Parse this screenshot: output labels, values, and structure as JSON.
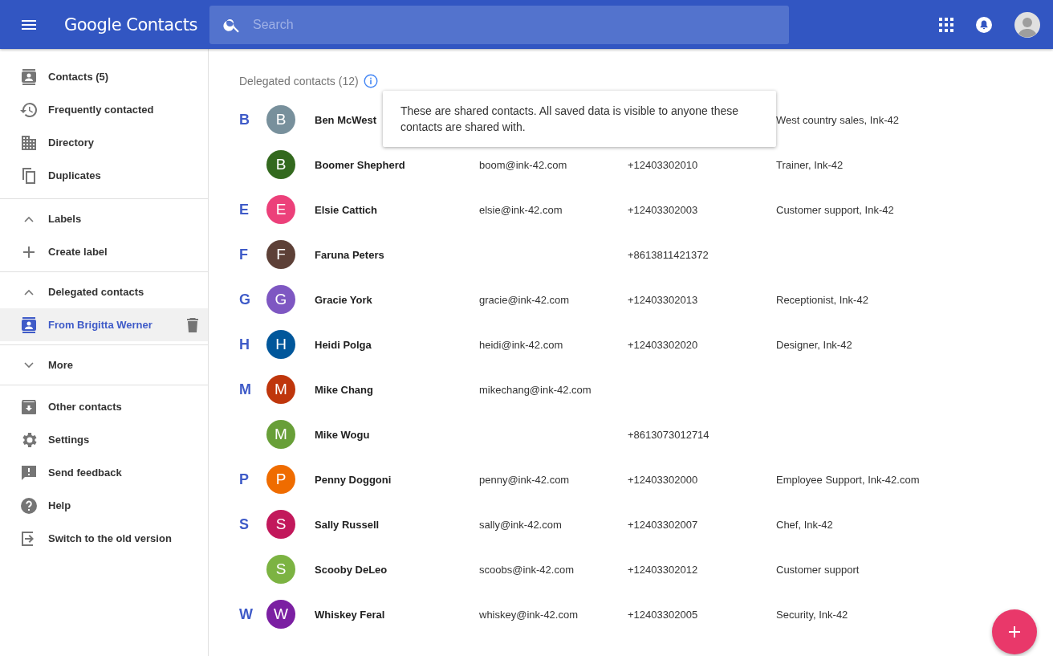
{
  "app_bar": {
    "title": "Google Contacts",
    "search": {
      "placeholder": "Search"
    }
  },
  "sidebar": {
    "groups": [
      {
        "items": [
          {
            "kind": "link",
            "label": "Contacts (5)",
            "selected": false
          },
          {
            "kind": "link",
            "label": "Frequently contacted",
            "selected": false
          },
          {
            "kind": "link",
            "label": "Directory",
            "selected": false
          },
          {
            "kind": "link",
            "label": "Duplicates",
            "selected": false
          }
        ]
      },
      {
        "items": [
          {
            "kind": "toggle",
            "label": "Labels",
            "expanded": true
          },
          {
            "kind": "add",
            "label": "Create label"
          }
        ]
      },
      {
        "items": [
          {
            "kind": "toggle",
            "label": "Delegated contacts",
            "expanded": true
          },
          {
            "kind": "link",
            "label": "From Brigitta Werner",
            "selected": true,
            "removable": true
          }
        ]
      },
      {
        "items": [
          {
            "kind": "toggle",
            "label": "More",
            "expanded": false
          }
        ]
      },
      {
        "items": [
          {
            "kind": "link",
            "label": "Other contacts",
            "selected": false
          },
          {
            "kind": "link",
            "label": "Settings",
            "selected": false
          },
          {
            "kind": "link",
            "label": "Send feedback",
            "selected": false
          },
          {
            "kind": "link",
            "label": "Help",
            "selected": false
          },
          {
            "kind": "link",
            "label": "Switch to the old version",
            "selected": false
          }
        ]
      }
    ]
  },
  "list": {
    "heading": "Delegated contacts (12)",
    "tooltip": "These are shared contacts. All saved data is visible to anyone these contacts are shared with.",
    "rows": [
      {
        "section": "B",
        "initial": "B",
        "color": "#78909c",
        "name": "Ben McWest",
        "title": "West country sales, Ink-42"
      },
      {
        "initial": "B",
        "color": "#33691e",
        "name": "Boomer Shepherd",
        "email": "boom@ink-42.com",
        "phone": "+12403302010",
        "title": "Trainer, Ink-42"
      },
      {
        "section": "E",
        "initial": "E",
        "color": "#ec407a",
        "name": "Elsie Cattich",
        "email": "elsie@ink-42.com",
        "phone": "+12403302003",
        "title": "Customer support, Ink-42"
      },
      {
        "section": "F",
        "initial": "F",
        "color": "#5d4037",
        "name": "Faruna Peters",
        "phone": "+8613811421372"
      },
      {
        "section": "G",
        "initial": "G",
        "color": "#7e57c2",
        "name": "Gracie York",
        "email": "gracie@ink-42.com",
        "phone": "+12403302013",
        "title": "Receptionist, Ink-42"
      },
      {
        "section": "H",
        "initial": "H",
        "color": "#01579b",
        "name": "Heidi Polga",
        "email": "heidi@ink-42.com",
        "phone": "+12403302020",
        "title": "Designer, Ink-42"
      },
      {
        "section": "M",
        "initial": "M",
        "color": "#bf360c",
        "name": "Mike Chang",
        "email": "mikechang@ink-42.com"
      },
      {
        "initial": "M",
        "color": "#689f38",
        "name": "Mike Wogu",
        "phone": "+8613073012714"
      },
      {
        "section": "P",
        "initial": "P",
        "color": "#ef6c00",
        "name": "Penny Doggoni",
        "email": "penny@ink-42.com",
        "phone": "+12403302000",
        "title": "Employee Support, Ink-42.com"
      },
      {
        "section": "S",
        "initial": "S",
        "color": "#c2185b",
        "name": "Sally Russell",
        "email": "sally@ink-42.com",
        "phone": "+12403302007",
        "title": "Chef, Ink-42"
      },
      {
        "initial": "S",
        "color": "#7cb342",
        "name": "Scooby DeLeo",
        "email": "scoobs@ink-42.com",
        "phone": "+12403302012",
        "title": "Customer support"
      },
      {
        "section": "W",
        "initial": "W",
        "color": "#7b1fa2",
        "name": "Whiskey Feral",
        "email": "whiskey@ink-42.com",
        "phone": "+12403302005",
        "title": "Security, Ink-42"
      }
    ]
  }
}
